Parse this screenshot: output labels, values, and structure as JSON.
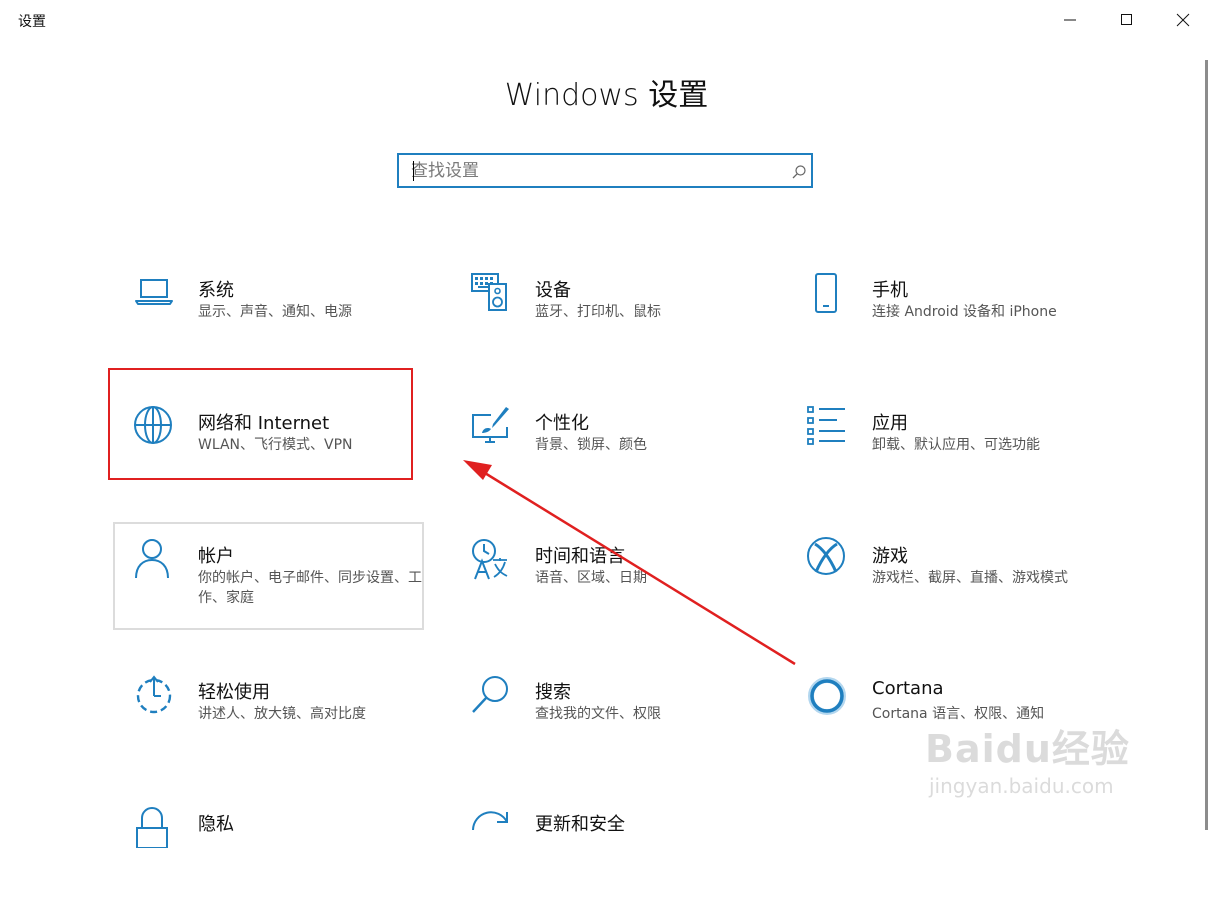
{
  "window": {
    "title": "设置"
  },
  "header": {
    "title": "Windows 设置"
  },
  "search": {
    "placeholder": "查找设置"
  },
  "tiles": [
    {
      "title": "系统",
      "subtitle": "显示、声音、通知、电源",
      "icon": "laptop-icon"
    },
    {
      "title": "设备",
      "subtitle": "蓝牙、打印机、鼠标",
      "icon": "keyboard-speaker-icon"
    },
    {
      "title": "手机",
      "subtitle": "连接 Android 设备和 iPhone",
      "icon": "phone-icon"
    },
    {
      "title": "网络和 Internet",
      "subtitle": "WLAN、飞行模式、VPN",
      "icon": "globe-icon"
    },
    {
      "title": "个性化",
      "subtitle": "背景、锁屏、颜色",
      "icon": "pen-tablet-icon"
    },
    {
      "title": "应用",
      "subtitle": "卸载、默认应用、可选功能",
      "icon": "apps-list-icon"
    },
    {
      "title": "帐户",
      "subtitle": "你的帐户、电子邮件、同步设置、工作、家庭",
      "icon": "person-icon"
    },
    {
      "title": "时间和语言",
      "subtitle": "语音、区域、日期",
      "icon": "clock-language-icon"
    },
    {
      "title": "游戏",
      "subtitle": "游戏栏、截屏、直播、游戏模式",
      "icon": "xbox-icon"
    },
    {
      "title": "轻松使用",
      "subtitle": "讲述人、放大镜、高对比度",
      "icon": "ease-of-access-icon"
    },
    {
      "title": "搜索",
      "subtitle": "查找我的文件、权限",
      "icon": "magnifier-icon"
    },
    {
      "title": "Cortana",
      "subtitle": "Cortana 语言、权限、通知",
      "icon": "cortana-ring-icon"
    },
    {
      "title": "隐私",
      "subtitle": "",
      "icon": "lock-icon"
    },
    {
      "title": "更新和安全",
      "subtitle": "",
      "icon": "sync-icon"
    }
  ],
  "watermark": {
    "main": "Baidu经验",
    "sub": "jingyan.baidu.com"
  },
  "colors": {
    "accent": "#1f7fbf",
    "annotation": "#e02020",
    "focus_border": "#dcdcdc"
  }
}
